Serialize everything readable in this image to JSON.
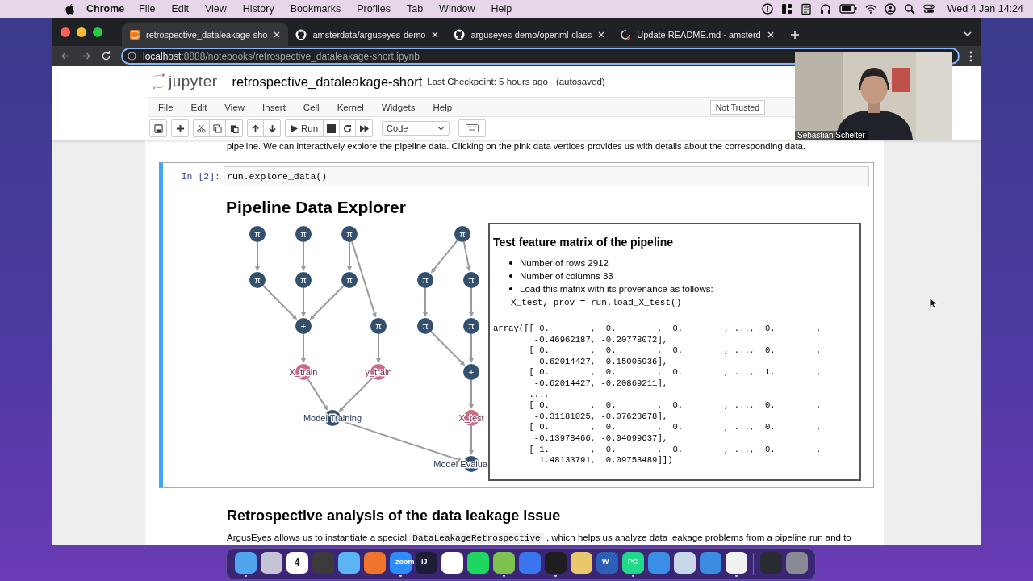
{
  "menubar": {
    "app": "Chrome",
    "menus": [
      "File",
      "Edit",
      "View",
      "History",
      "Bookmarks",
      "Profiles",
      "Tab",
      "Window",
      "Help"
    ],
    "clock": "Wed 4 Jan  14:24"
  },
  "browser": {
    "tabs": [
      {
        "title": "retrospective_dataleakage-sho",
        "selected": true
      },
      {
        "title": "amsterdata/arguseyes-demo",
        "selected": false
      },
      {
        "title": "arguseyes-demo/openml-class",
        "selected": false
      },
      {
        "title": "Update README.md · amsterd",
        "selected": false
      }
    ],
    "url_host": "localhost",
    "url_rest": ":8888/notebooks/retrospective_dataleakage-short.ipynb"
  },
  "notebook": {
    "logo": "jupyter",
    "name": "retrospective_dataleakage-short",
    "checkpoint": "Last Checkpoint: 5 hours ago",
    "autosave": "(autosaved)",
    "menus": [
      "File",
      "Edit",
      "View",
      "Insert",
      "Cell",
      "Kernel",
      "Widgets",
      "Help"
    ],
    "trust": "Not Trusted",
    "run_label": "Run",
    "cell_type": "Code"
  },
  "intro": "pipeline. We can interactively explore the pipeline data. Clicking on the pink data vertices provides us with details about the corresponding data.",
  "cell": {
    "prompt": "In [2]:",
    "code": "run.explore_data()"
  },
  "explorer": {
    "title": "Pipeline Data Explorer",
    "nodes": [
      {
        "label": "π",
        "kind": "op"
      },
      {
        "label": "π",
        "kind": "op"
      },
      {
        "label": "π",
        "kind": "op"
      },
      {
        "label": "π",
        "kind": "op"
      },
      {
        "label": "π",
        "kind": "op"
      },
      {
        "label": "π",
        "kind": "op"
      },
      {
        "label": "+",
        "kind": "op"
      },
      {
        "label": "π",
        "kind": "op"
      },
      {
        "label": "X_train",
        "kind": "data"
      },
      {
        "label": "y_train",
        "kind": "data"
      },
      {
        "label": "Model Training",
        "kind": "model"
      },
      {
        "label": "π",
        "kind": "op"
      },
      {
        "label": "π",
        "kind": "op"
      },
      {
        "label": "π",
        "kind": "op"
      },
      {
        "label": "π",
        "kind": "op"
      },
      {
        "label": "π",
        "kind": "op"
      },
      {
        "label": "+",
        "kind": "op"
      },
      {
        "label": "X_test",
        "kind": "data"
      },
      {
        "label": "Model Evalua",
        "kind": "model"
      }
    ],
    "popup": {
      "title": "Test feature matrix of the pipeline",
      "bullets": [
        "Number of rows 2912",
        "Number of columns 33",
        "Load this matrix with its provenance as follows:"
      ],
      "code": "X_test, prov = run.load_X_test()",
      "array": [
        "array([[ 0.        ,  0.        ,  0.        , ...,  0.        ,",
        "        -0.46962187, -0.20778072],",
        "       [ 0.        ,  0.        ,  0.        , ...,  0.        ,",
        "        -0.62014427, -0.15005936],",
        "       [ 0.        ,  0.        ,  0.        , ...,  1.        ,",
        "        -0.62014427, -0.20869211],",
        "       ...,",
        "       [ 0.        ,  0.        ,  0.        , ...,  0.        ,",
        "        -0.31181025, -0.07623678],",
        "       [ 0.        ,  0.        ,  0.        , ...,  0.        ,",
        "        -0.13978466, -0.04099637],",
        "       [ 1.        ,  0.        ,  0.        , ...,  0.        ,",
        "         1.48133791,  0.09753489]])"
      ]
    }
  },
  "section": {
    "heading": "Retrospective analysis of the data leakage issue",
    "text_before": "ArgusEyes allows us to instantiate a special ",
    "code": "DataLeakageRetrospective",
    "text_after": " , which helps us analyze data leakage problems from a pipeline run and to"
  },
  "webcam": {
    "kind": "picture",
    "caption": "Sebastian Schelter"
  },
  "dock": [
    {
      "color": "#4fa6ee",
      "running": true
    },
    {
      "color": "#c4c4d4",
      "running": false
    },
    {
      "color": "#ffffff",
      "label": "4",
      "running": false
    },
    {
      "color": "#3b3b3b",
      "running": false
    },
    {
      "color": "#5db4f4",
      "running": false
    },
    {
      "color": "#f0742a",
      "running": false
    },
    {
      "color": "#2d8cff",
      "label": "zoom",
      "running": true
    },
    {
      "color": "#1d1d3a",
      "label": "IJ",
      "running": false
    },
    {
      "color": "#ffffff",
      "running": false
    },
    {
      "color": "#1ed760",
      "running": false
    },
    {
      "color": "#7cc24e",
      "running": true
    },
    {
      "color": "#3a76f0",
      "running": false
    },
    {
      "color": "#1e1e1e",
      "running": true
    },
    {
      "color": "#e8c86a",
      "running": false
    },
    {
      "color": "#2b5fb8",
      "label": "W",
      "running": false
    },
    {
      "color": "#21d789",
      "label": "PC",
      "running": true
    },
    {
      "color": "#3b8ee6",
      "running": false
    },
    {
      "color": "#c8d8e8",
      "running": false
    },
    {
      "color": "#3b8be0",
      "running": false
    },
    {
      "color": "#f1f1f1",
      "running": true
    },
    {
      "color": "#2a2a33",
      "running": false
    },
    {
      "color": "#8a8a94",
      "running": false
    }
  ]
}
